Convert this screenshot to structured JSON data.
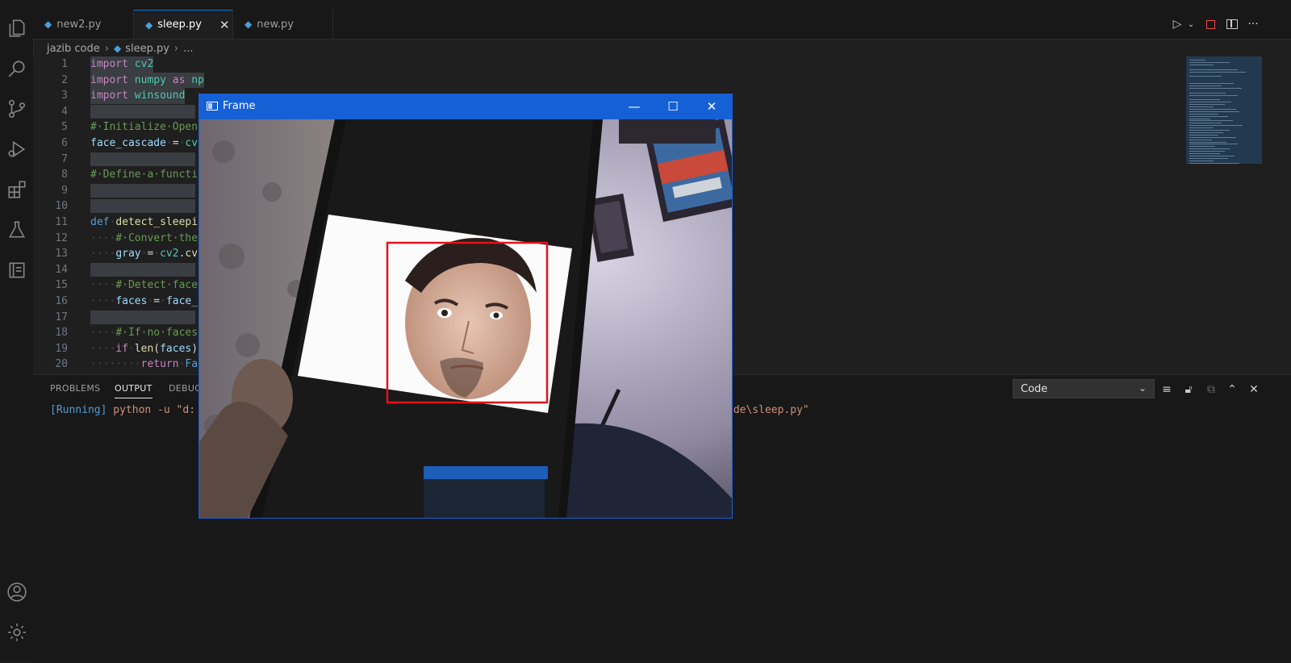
{
  "tabs": [
    {
      "label": "new2.py",
      "active": false
    },
    {
      "label": "sleep.py",
      "active": true
    },
    {
      "label": "new.py",
      "active": false
    }
  ],
  "breadcrumb": {
    "folder": "jazib code",
    "file": "sleep.py",
    "more": "..."
  },
  "activity_icons": [
    "files-icon",
    "search-icon",
    "source-control-icon",
    "run-debug-icon",
    "extensions-icon",
    "testing-icon",
    "remote-explorer-icon",
    "account-icon",
    "settings-gear-icon"
  ],
  "editor": {
    "lines": [
      {
        "n": "1",
        "segs": [
          [
            "kw",
            "import"
          ],
          [
            "sp",
            "·"
          ],
          [
            "mod",
            "cv2"
          ]
        ]
      },
      {
        "n": "2",
        "segs": [
          [
            "kw",
            "import"
          ],
          [
            "sp",
            "·"
          ],
          [
            "mod",
            "numpy"
          ],
          [
            "sp",
            "·"
          ],
          [
            "kw",
            "as"
          ],
          [
            "sp",
            "·"
          ],
          [
            "mod",
            "np"
          ]
        ]
      },
      {
        "n": "3",
        "segs": [
          [
            "kw",
            "import"
          ],
          [
            "sp",
            "·"
          ],
          [
            "mod",
            "winsound"
          ]
        ]
      },
      {
        "n": "4",
        "segs": []
      },
      {
        "n": "5",
        "segs": [
          [
            "cm",
            "#·Initialize·Open"
          ]
        ]
      },
      {
        "n": "6",
        "segs": [
          [
            "vr",
            "face_cascade"
          ],
          [
            "sp",
            "·"
          ],
          [
            "op",
            "="
          ],
          [
            "sp",
            "·"
          ],
          [
            "mod",
            "cv"
          ]
        ]
      },
      {
        "n": "7",
        "segs": []
      },
      {
        "n": "8",
        "segs": [
          [
            "cm",
            "#·Define·a·functi"
          ]
        ]
      },
      {
        "n": "9",
        "segs": []
      },
      {
        "n": "10",
        "segs": []
      },
      {
        "n": "11",
        "segs": [
          [
            "df",
            "def"
          ],
          [
            "sp",
            "·"
          ],
          [
            "fn",
            "detect_sleepi"
          ]
        ]
      },
      {
        "n": "12",
        "segs": [
          [
            "sp",
            "····"
          ],
          [
            "cm",
            "#·Convert·the"
          ]
        ]
      },
      {
        "n": "13",
        "segs": [
          [
            "sp",
            "····"
          ],
          [
            "vr",
            "gray"
          ],
          [
            "sp",
            "·"
          ],
          [
            "op",
            "="
          ],
          [
            "sp",
            "·"
          ],
          [
            "mod",
            "cv2"
          ],
          [
            "op",
            "."
          ],
          [
            "fn",
            "cv"
          ]
        ]
      },
      {
        "n": "14",
        "segs": []
      },
      {
        "n": "15",
        "segs": [
          [
            "sp",
            "····"
          ],
          [
            "cm",
            "#·Detect·face"
          ]
        ]
      },
      {
        "n": "16",
        "segs": [
          [
            "sp",
            "····"
          ],
          [
            "vr",
            "faces"
          ],
          [
            "sp",
            "·"
          ],
          [
            "op",
            "="
          ],
          [
            "sp",
            "·"
          ],
          [
            "vr",
            "face_"
          ]
        ]
      },
      {
        "n": "17",
        "segs": []
      },
      {
        "n": "18",
        "segs": [
          [
            "sp",
            "····"
          ],
          [
            "cm",
            "#·If·no·faces"
          ]
        ]
      },
      {
        "n": "19",
        "segs": [
          [
            "sp",
            "····"
          ],
          [
            "kw",
            "if"
          ],
          [
            "sp",
            "·"
          ],
          [
            "fn",
            "len"
          ],
          [
            "op",
            "("
          ],
          [
            "vr",
            "faces"
          ],
          [
            "op",
            ")"
          ]
        ]
      },
      {
        "n": "20",
        "segs": [
          [
            "sp",
            "········"
          ],
          [
            "kw",
            "return"
          ],
          [
            "sp",
            "·"
          ],
          [
            "df",
            "Fa"
          ]
        ]
      }
    ]
  },
  "panel": {
    "tabs": [
      "PROBLEMS",
      "OUTPUT",
      "DEBUG"
    ],
    "active_tab": "OUTPUT",
    "channel_select": "Code",
    "output_running": "[Running]",
    "output_cmd": "python -u \"d:",
    "output_tail": "ode\\sleep.py\""
  },
  "frame_window": {
    "title": "Frame"
  },
  "colors": {
    "accent": "#0078d4",
    "frame_titlebar": "#1660d6",
    "detection_box": "#e3121b"
  }
}
